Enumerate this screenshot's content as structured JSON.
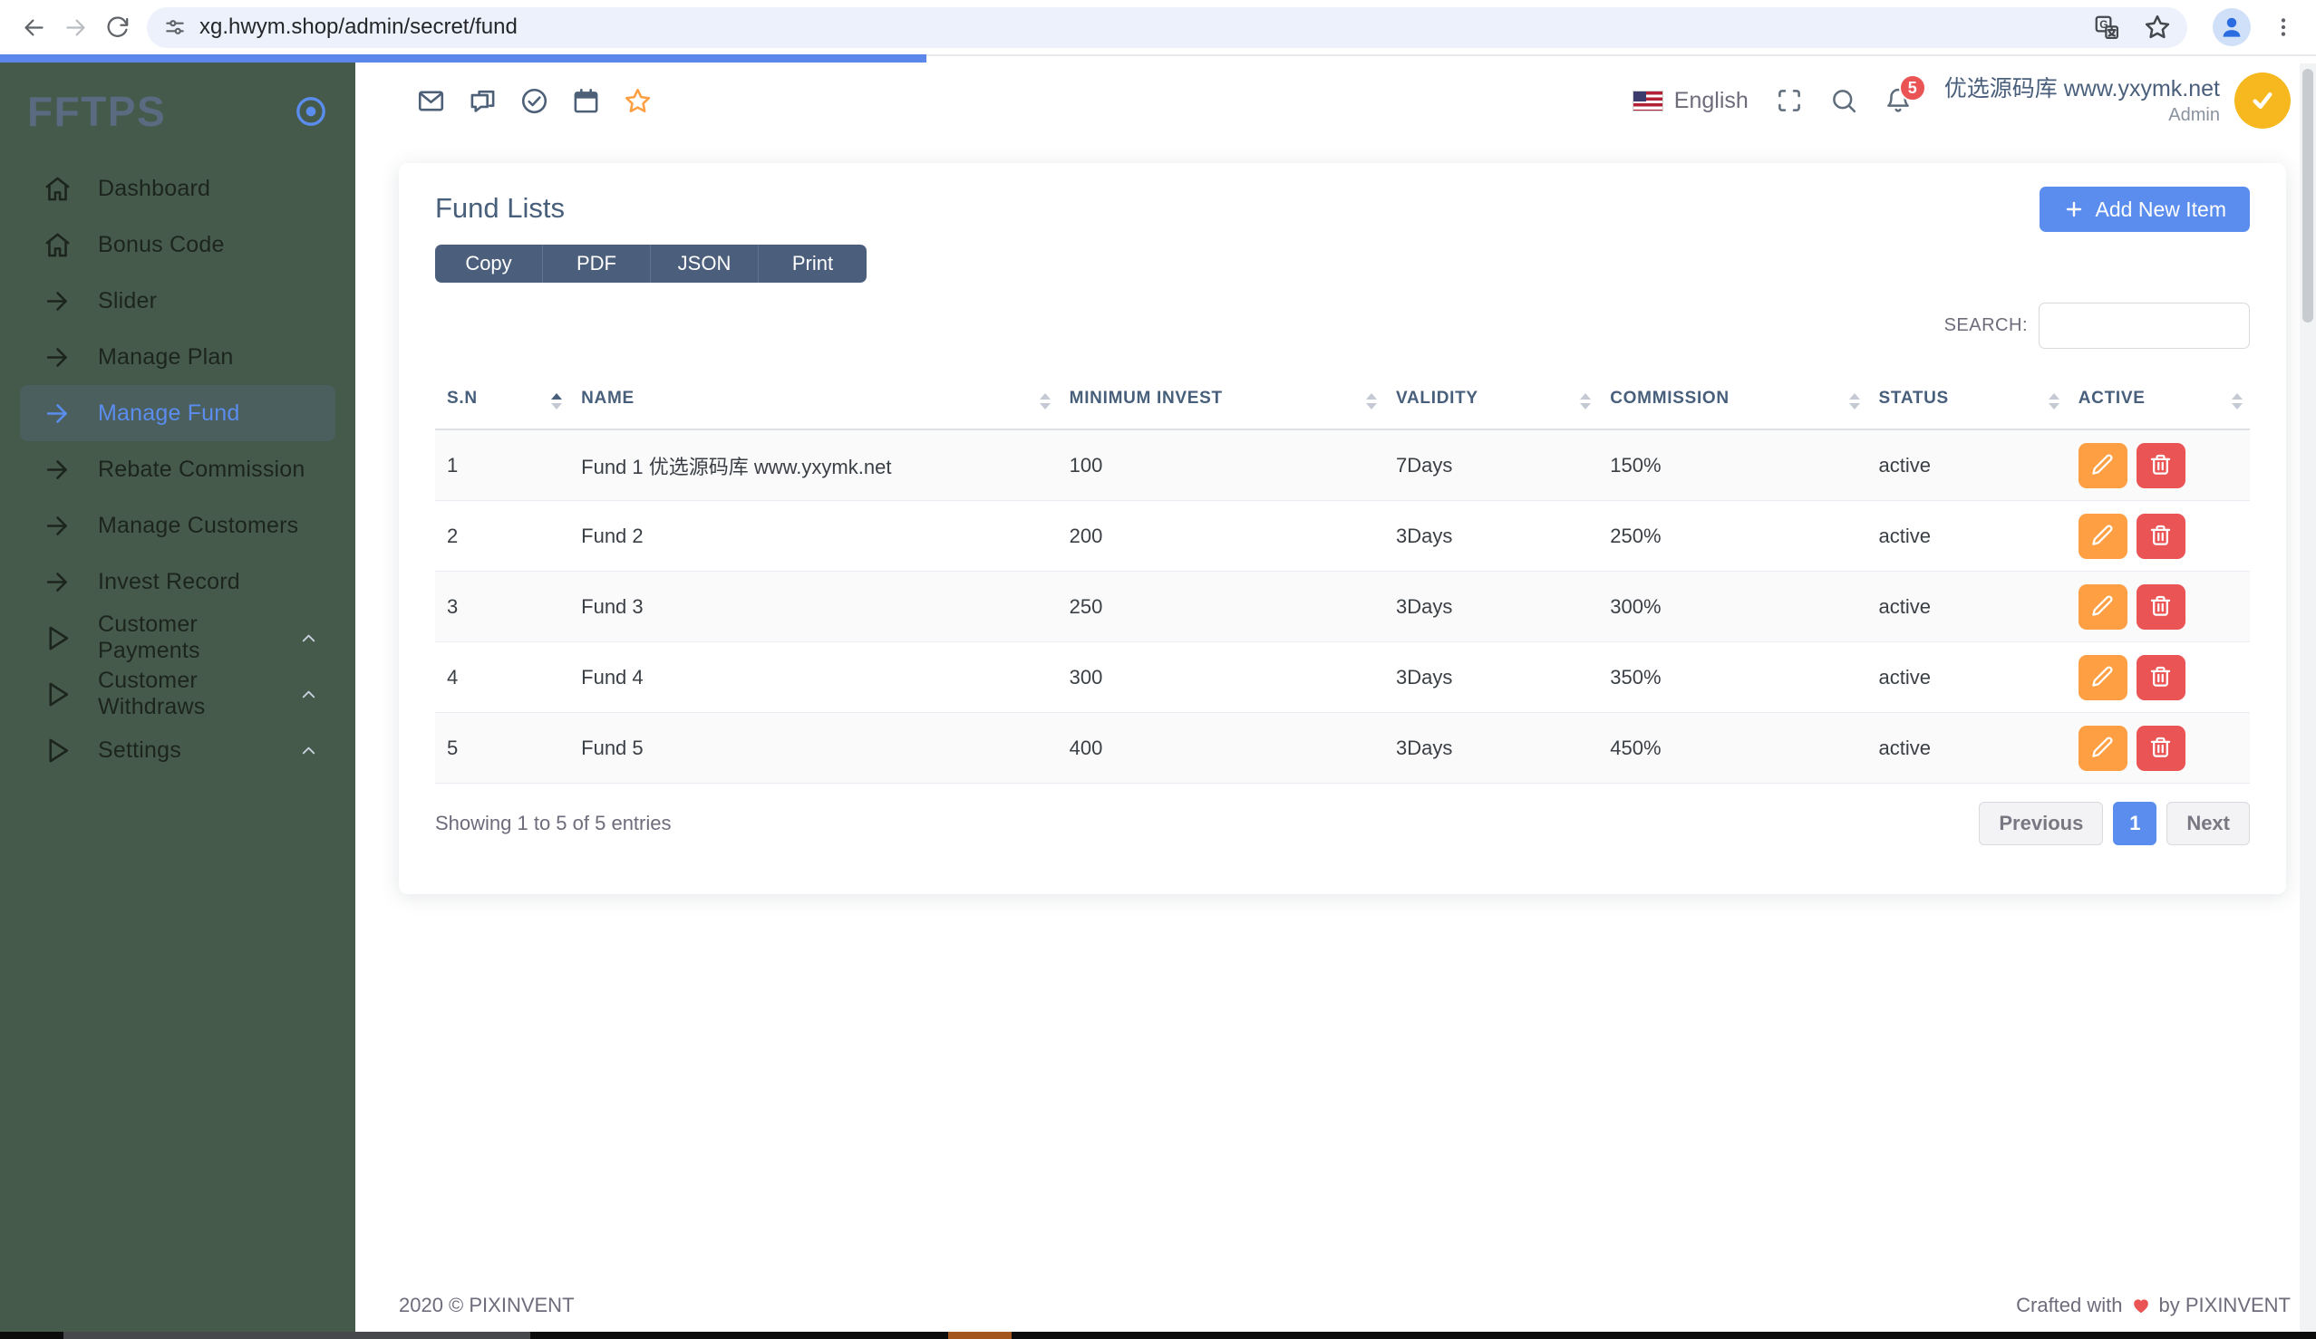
{
  "browser": {
    "url": "xg.hwym.shop/admin/secret/fund",
    "loading_progress_pct": 40
  },
  "sidebar": {
    "brand": "FFTPS",
    "items": [
      {
        "label": "Dashboard",
        "icon": "home",
        "active": false,
        "expandable": false
      },
      {
        "label": "Bonus Code",
        "icon": "home",
        "active": false,
        "expandable": false
      },
      {
        "label": "Slider",
        "icon": "arrow-right",
        "active": false,
        "expandable": false
      },
      {
        "label": "Manage Plan",
        "icon": "arrow-right",
        "active": false,
        "expandable": false
      },
      {
        "label": "Manage Fund",
        "icon": "arrow-right",
        "active": true,
        "expandable": false
      },
      {
        "label": "Rebate Commission",
        "icon": "arrow-right",
        "active": false,
        "expandable": false
      },
      {
        "label": "Manage Customers",
        "icon": "arrow-right",
        "active": false,
        "expandable": false
      },
      {
        "label": "Invest Record",
        "icon": "arrow-right",
        "active": false,
        "expandable": false
      },
      {
        "label": "Customer Payments",
        "icon": "play",
        "active": false,
        "expandable": true
      },
      {
        "label": "Customer Withdraws",
        "icon": "play",
        "active": false,
        "expandable": true
      },
      {
        "label": "Settings",
        "icon": "play",
        "active": false,
        "expandable": true
      }
    ]
  },
  "topbar": {
    "quick_icons": [
      "mail",
      "chat",
      "check-circle",
      "calendar",
      "star"
    ],
    "language": "English",
    "notification_count": "5",
    "user_name": "优选源码库 www.yxymk.net",
    "user_role": "Admin"
  },
  "page": {
    "title": "Fund Lists",
    "export_buttons": [
      "Copy",
      "PDF",
      "JSON",
      "Print"
    ],
    "add_button_label": "Add New Item",
    "search_label": "SEARCH:",
    "search_value": "",
    "table": {
      "columns": [
        "S.N",
        "NAME",
        "MINIMUM INVEST",
        "VALIDITY",
        "COMMISSION",
        "STATUS",
        "ACTIVE"
      ],
      "sorted_column_index": 0,
      "sorted_direction": "asc",
      "rows": [
        {
          "sn": "1",
          "name": "Fund 1 优选源码库 www.yxymk.net",
          "minimum_invest": "100",
          "validity": "7Days",
          "commission": "150%",
          "status": "active"
        },
        {
          "sn": "2",
          "name": "Fund 2",
          "minimum_invest": "200",
          "validity": "3Days",
          "commission": "250%",
          "status": "active"
        },
        {
          "sn": "3",
          "name": "Fund 3",
          "minimum_invest": "250",
          "validity": "3Days",
          "commission": "300%",
          "status": "active"
        },
        {
          "sn": "4",
          "name": "Fund 4",
          "minimum_invest": "300",
          "validity": "3Days",
          "commission": "350%",
          "status": "active"
        },
        {
          "sn": "5",
          "name": "Fund 5",
          "minimum_invest": "400",
          "validity": "3Days",
          "commission": "450%",
          "status": "active"
        }
      ]
    },
    "summary": "Showing 1 to 5 of 5 entries",
    "pagination": {
      "previous": "Previous",
      "pages": [
        "1"
      ],
      "active_page": "1",
      "next": "Next"
    }
  },
  "footer": {
    "copyright": "2020 © PIXINVENT",
    "crafted_prefix": "Crafted with",
    "crafted_suffix": "by PIXINVENT"
  },
  "colors": {
    "accent_blue": "#5a8dee",
    "sidebar_green": "#465a4b",
    "sidebar_active_green": "#4b5f5e",
    "heading_blue": "#475f7b",
    "export_button_slate": "#4b5f7d",
    "warning_orange": "#ff9f43",
    "danger_red": "#ea5455",
    "progress_blue": "#5b87ea",
    "avatar_yellow": "#f6b81e"
  }
}
